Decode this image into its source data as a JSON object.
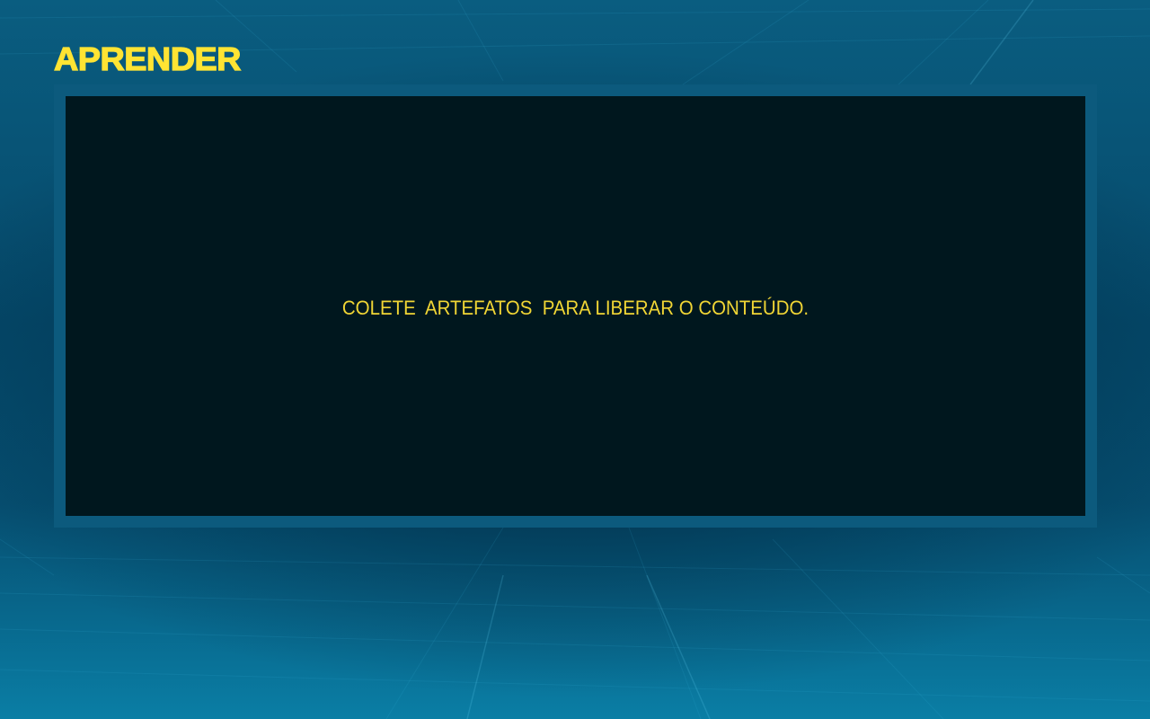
{
  "screen": {
    "title": "APRENDER"
  },
  "content": {
    "locked_message": "COLETE  ARTEFATOS  PARA LIBERAR O CONTEÚDO."
  },
  "colors": {
    "title": "#ffe433",
    "message": "#f1d635",
    "frame": "#0c5a7d",
    "panel": "#00171e",
    "background": "#05496a"
  }
}
